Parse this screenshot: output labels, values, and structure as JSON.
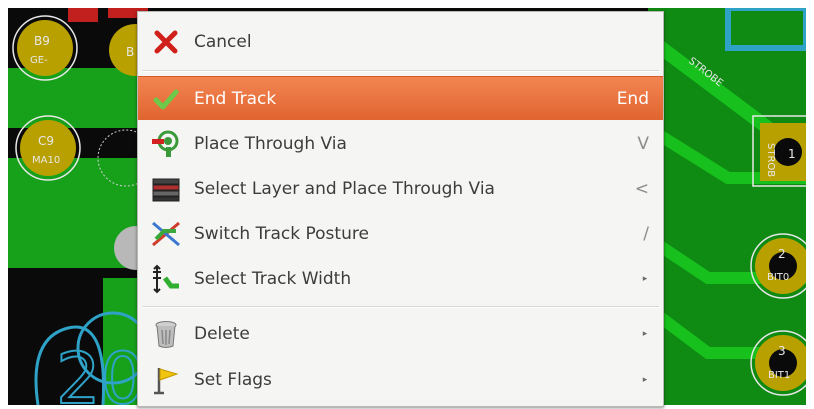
{
  "board": {
    "pads": [
      {
        "id": "b9",
        "label_top": "B9",
        "label_bottom": "GE-"
      },
      {
        "id": "b-partial",
        "label_top": "B",
        "label_bottom": ""
      },
      {
        "id": "c9",
        "label_top": "C9",
        "label_bottom": "MA10"
      },
      {
        "id": "p1",
        "label_top": "1",
        "label_bottom": "STROB"
      },
      {
        "id": "p2",
        "label_top": "2",
        "label_bottom": "BIT0"
      },
      {
        "id": "p3",
        "label_top": "3",
        "label_bottom": "BIT1"
      }
    ],
    "net_label": "STROBE",
    "silk_text": "20"
  },
  "context_menu": {
    "items": [
      {
        "id": "cancel",
        "label": "Cancel",
        "shortcut": "",
        "submenu": false,
        "icon": "red-x-icon",
        "highlighted": false
      },
      {
        "id": "end-track",
        "label": "End Track",
        "shortcut": "End",
        "submenu": false,
        "icon": "checkmark-icon",
        "highlighted": true
      },
      {
        "id": "place-through-via",
        "label": "Place Through Via",
        "shortcut": "V",
        "submenu": false,
        "icon": "via-icon",
        "highlighted": false
      },
      {
        "id": "select-layer-place-via",
        "label": "Select Layer and Place Through Via",
        "shortcut": "<",
        "submenu": false,
        "icon": "layers-icon",
        "highlighted": false
      },
      {
        "id": "switch-track-posture",
        "label": "Switch Track Posture",
        "shortcut": "/",
        "submenu": false,
        "icon": "posture-icon",
        "highlighted": false
      },
      {
        "id": "select-track-width",
        "label": "Select Track Width",
        "shortcut": "",
        "submenu": true,
        "icon": "track-width-icon",
        "highlighted": false
      },
      {
        "id": "delete",
        "label": "Delete",
        "shortcut": "",
        "submenu": true,
        "icon": "trash-icon",
        "highlighted": false
      },
      {
        "id": "set-flags",
        "label": "Set Flags",
        "shortcut": "",
        "submenu": true,
        "icon": "flag-icon",
        "highlighted": false
      }
    ],
    "submenu_glyph": "▸"
  },
  "colors": {
    "highlight": "#e8703a",
    "copper_green": "#139c16",
    "copper_red": "#c21f1f",
    "pad_gold": "#b8a000",
    "silk_cyan": "#2fa2c8"
  }
}
